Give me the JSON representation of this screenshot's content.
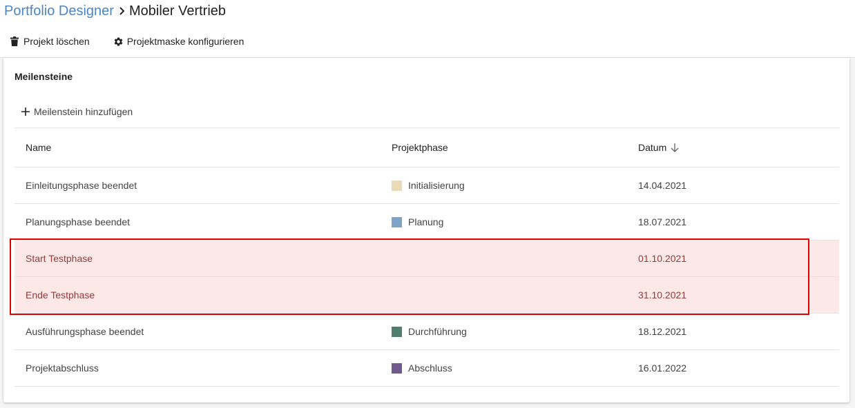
{
  "breadcrumb": {
    "root": "Portfolio Designer",
    "current": "Mobiler Vertrieb"
  },
  "toolbar": {
    "delete_label": "Projekt löschen",
    "configure_label": "Projektmaske konfigurieren"
  },
  "milestones": {
    "title": "Meilensteine",
    "add_label": "Meilenstein hinzufügen",
    "columns": {
      "name": "Name",
      "phase": "Projektphase",
      "date": "Datum"
    },
    "sort": {
      "column": "Datum",
      "direction": "descending-arrow"
    },
    "rows": [
      {
        "name": "Einleitungsphase beendet",
        "phase": "Initialisierung",
        "phase_color": "#e8dcb8",
        "date": "14.04.2021"
      },
      {
        "name": "Planungsphase beendet",
        "phase": "Planung",
        "phase_color": "#7fa3c8",
        "date": "18.07.2021"
      },
      {
        "name": "Start Testphase",
        "phase": "",
        "phase_color": "",
        "date": "01.10.2021",
        "highlighted": true
      },
      {
        "name": "Ende Testphase",
        "phase": "",
        "phase_color": "",
        "date": "31.10.2021",
        "highlighted": true
      },
      {
        "name": "Ausführungsphase beendet",
        "phase": "Durchführung",
        "phase_color": "#4f7f6c",
        "date": "18.12.2021"
      },
      {
        "name": "Projektabschluss",
        "phase": "Abschluss",
        "phase_color": "#6e5a8c",
        "date": "16.01.2022"
      }
    ]
  },
  "colors": {
    "link": "#4a86c5",
    "highlight_bg": "#fde8e8",
    "highlight_border": "#e00000",
    "highlight_text": "#8e3b3b"
  }
}
